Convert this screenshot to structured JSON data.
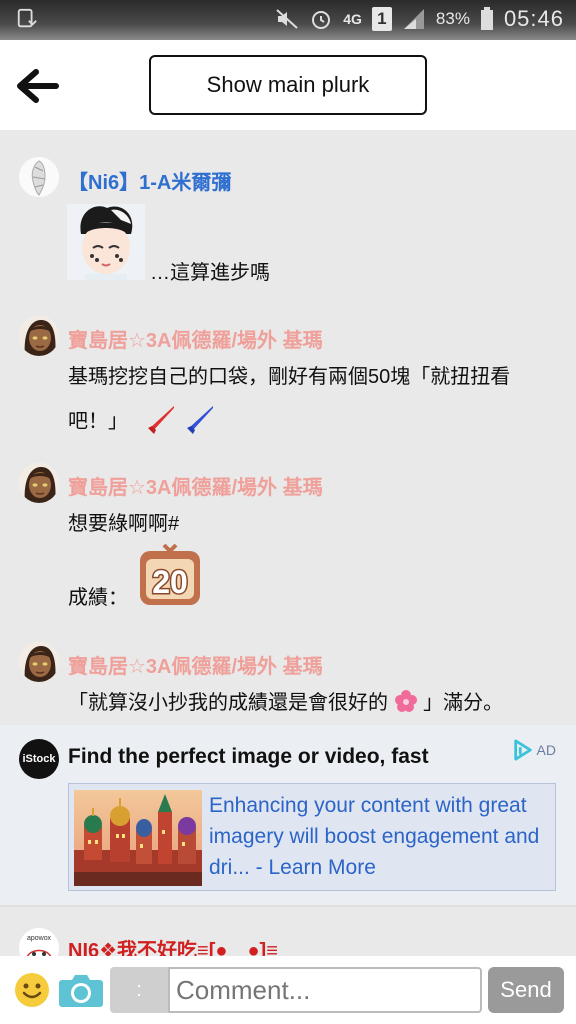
{
  "status_bar": {
    "network": "4G",
    "sim": "1",
    "battery": "83%",
    "time": "05:46"
  },
  "header": {
    "show_main_label": "Show main plurk"
  },
  "responses": [
    {
      "name": "【Ni6】1-A米爾彌",
      "name_color": "#2f6fd0",
      "text": "…這算進步嗎"
    },
    {
      "name": "寶島居☆3A佩德羅/場外 基瑪",
      "name_color": "#f0a09a",
      "text_line1": "基瑪挖挖自己的口袋，剛好有兩個50塊「就扭扭看",
      "text_line2": "吧！」"
    },
    {
      "name": "寶島居☆3A佩德羅/場外 基瑪",
      "name_color": "#f0a09a",
      "text_line1": "想要綠啊啊#",
      "text_line2": "成績：",
      "score": "20"
    },
    {
      "name": "寶島居☆3A佩德羅/場外 基瑪",
      "name_color": "#f0a09a",
      "text_before": "「就算沒小抄我的成績還是會很好的",
      "text_after": "」滿分。"
    }
  ],
  "ad": {
    "logo_text": "iStock",
    "title": "Find the perfect image or video, fast",
    "badge": "AD",
    "body": "Enhancing your content with great imagery will boost engagement and dri... - Learn More"
  },
  "next_response": {
    "avatar_text": "ароwох",
    "name": "NI6❖我不好吃≡[●﹏●]≡",
    "name_color": "#d02020"
  },
  "bottom_bar": {
    "colon": ":",
    "comment_placeholder": "Comment...",
    "send_label": "Send"
  }
}
